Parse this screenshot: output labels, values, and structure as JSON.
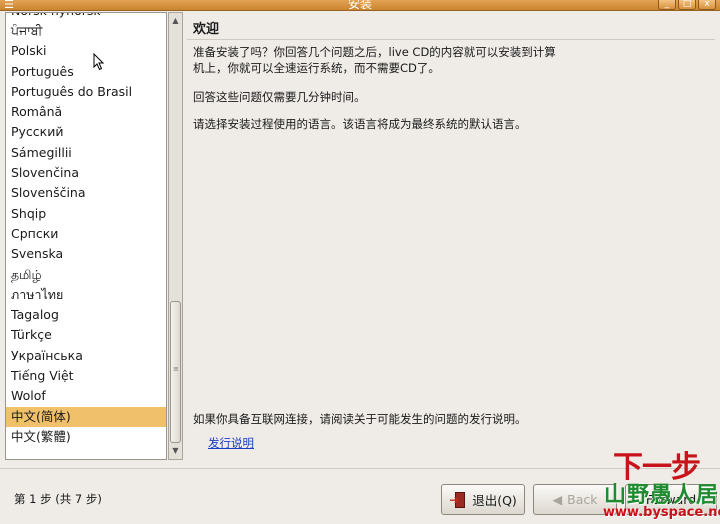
{
  "window": {
    "title": "安装",
    "menu_icon": "☰",
    "minimize": "_",
    "maximize": "□",
    "close": "x"
  },
  "language_list": {
    "items": [
      "Norsk nynorsk",
      "ਪੰਜਾਬੀ",
      "Polski",
      "Português",
      "Português do Brasil",
      "Română",
      "Русский",
      "Sámegillii",
      "Slovenčina",
      "Slovenščina",
      "Shqip",
      "Српски",
      "Svenska",
      "தமிழ்",
      "ภาษาไทย",
      "Tagalog",
      "Türkçe",
      "Українська",
      "Tiếng Việt",
      "Wolof",
      "中文(简体)",
      "中文(繁體)"
    ],
    "selected": "中文(简体)"
  },
  "welcome": {
    "heading": "欢迎",
    "para1": "准备安装了吗？你回答几个问题之后，live CD的内容就可以安装到计算机上，你就可以全速运行系统，而不需要CD了。",
    "para2": "回答这些问题仅需要几分钟时间。",
    "para3": "请选择安装过程使用的语言。该语言将成为最终系统的默认语言。",
    "para4": "如果你具备互联网连接，请阅读关于可能发生的问题的发行说明。",
    "release_notes_link": "发行说明"
  },
  "footer": {
    "step_text": "第 1 步 (共 7 步)",
    "quit_label": "退出(Q)",
    "back_label": "Back",
    "forward_label": "Forward"
  },
  "watermark": {
    "next_step": "下一步",
    "brand": "山野愚人居",
    "url": "www.byspace.net"
  },
  "icons": {
    "scroll_up": "▲",
    "scroll_down": "▼",
    "back_arrow": "◀",
    "grip": "≡",
    "quit_arrow": "➔"
  },
  "colors": {
    "titlebar": "#d08c37",
    "selection": "#f0c06a",
    "link": "#1a3ec2"
  }
}
